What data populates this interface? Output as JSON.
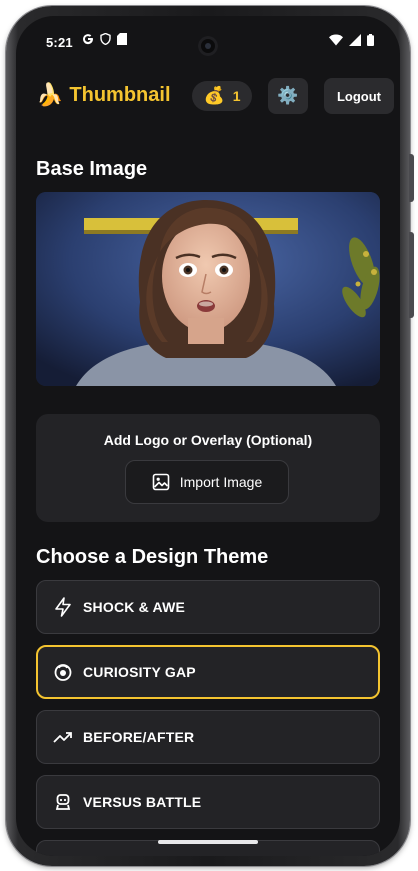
{
  "status_bar": {
    "time": "5:21"
  },
  "header": {
    "brand_emoji": "🍌",
    "brand_title": "Thumbnail",
    "coin_emoji": "💰",
    "coin_count": "1",
    "settings_emoji": "⚙️",
    "logout_label": "Logout"
  },
  "base_image": {
    "title": "Base Image"
  },
  "overlay": {
    "label": "Add Logo or Overlay (Optional)",
    "import_label": "Import Image"
  },
  "themes": {
    "title": "Choose a Design Theme",
    "items": [
      {
        "label": "SHOCK & AWE",
        "icon": "lightning-icon",
        "selected": false
      },
      {
        "label": "CURIOSITY GAP",
        "icon": "brain-icon",
        "selected": true
      },
      {
        "label": "BEFORE/AFTER",
        "icon": "trending-up-icon",
        "selected": false
      },
      {
        "label": "VERSUS BATTLE",
        "icon": "robot-icon",
        "selected": false
      }
    ]
  },
  "colors": {
    "accent": "#f4c430",
    "background": "#141416",
    "card": "#232326"
  }
}
